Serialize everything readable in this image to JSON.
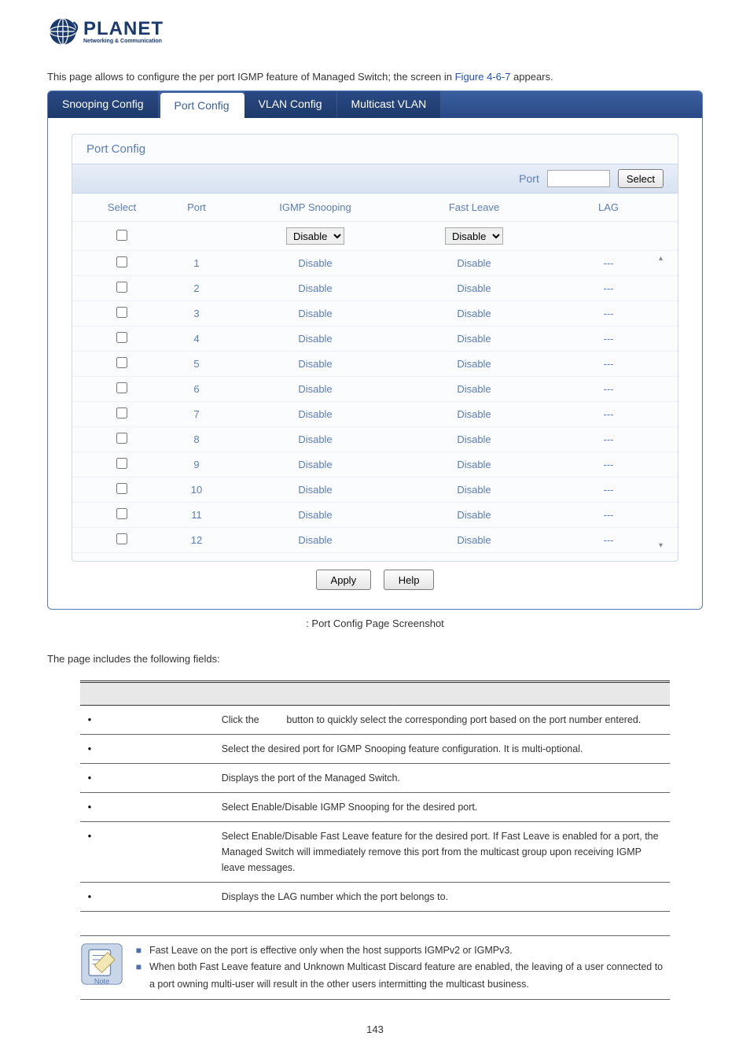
{
  "logo": {
    "main": "PLANET",
    "sub": "Networking & Communication"
  },
  "intro": {
    "prefix": "This page allows to configure the per port IGMP feature of Managed Switch; the screen in ",
    "link": "Figure 4-6-7",
    "suffix": " appears."
  },
  "tabs": [
    "Snooping Config",
    "Port Config",
    "VLAN Config",
    "Multicast VLAN"
  ],
  "activeTab": 1,
  "section": {
    "title": "Port Config",
    "portLabel": "Port",
    "selectBtn": "Select"
  },
  "headers": {
    "select": "Select",
    "port": "Port",
    "igmp": "IGMP Snooping",
    "fast": "Fast Leave",
    "lag": "LAG"
  },
  "dropdowns": {
    "igmp": "Disable",
    "fast": "Disable"
  },
  "rows": [
    {
      "port": "1",
      "igmp": "Disable",
      "fast": "Disable",
      "lag": "---"
    },
    {
      "port": "2",
      "igmp": "Disable",
      "fast": "Disable",
      "lag": "---"
    },
    {
      "port": "3",
      "igmp": "Disable",
      "fast": "Disable",
      "lag": "---"
    },
    {
      "port": "4",
      "igmp": "Disable",
      "fast": "Disable",
      "lag": "---"
    },
    {
      "port": "5",
      "igmp": "Disable",
      "fast": "Disable",
      "lag": "---"
    },
    {
      "port": "6",
      "igmp": "Disable",
      "fast": "Disable",
      "lag": "---"
    },
    {
      "port": "7",
      "igmp": "Disable",
      "fast": "Disable",
      "lag": "---"
    },
    {
      "port": "8",
      "igmp": "Disable",
      "fast": "Disable",
      "lag": "---"
    },
    {
      "port": "9",
      "igmp": "Disable",
      "fast": "Disable",
      "lag": "---"
    },
    {
      "port": "10",
      "igmp": "Disable",
      "fast": "Disable",
      "lag": "---"
    },
    {
      "port": "11",
      "igmp": "Disable",
      "fast": "Disable",
      "lag": "---"
    },
    {
      "port": "12",
      "igmp": "Disable",
      "fast": "Disable",
      "lag": "---"
    }
  ],
  "buttons": {
    "apply": "Apply",
    "help": "Help"
  },
  "caption": ": Port Config Page Screenshot",
  "fieldsIntro": "The page includes the following fields:",
  "fields": [
    {
      "desc_a": "Click the ",
      "desc_b": " button to quickly select the corresponding port based on the port number entered."
    },
    {
      "desc": "Select the desired port for IGMP Snooping feature configuration. It is multi-optional."
    },
    {
      "desc": "Displays the port of the Managed Switch."
    },
    {
      "desc": "Select Enable/Disable IGMP Snooping for the desired port."
    },
    {
      "desc": "Select Enable/Disable Fast Leave feature for the desired port. If Fast Leave is enabled for a port, the Managed Switch will immediately remove this port from the multicast group upon receiving IGMP leave messages."
    },
    {
      "desc": "Displays the LAG number which the port belongs to."
    }
  ],
  "noteLabel": "Note",
  "notes": [
    "Fast Leave on the port is effective only when the host supports IGMPv2 or IGMPv3.",
    "When both Fast Leave feature and Unknown Multicast Discard feature are enabled, the leaving of a user connected to a port owning multi-user will result in the other users intermitting the multicast business."
  ],
  "pageNum": "143"
}
